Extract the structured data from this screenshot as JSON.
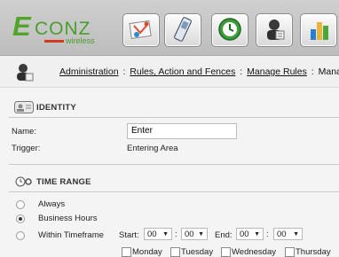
{
  "logo": {
    "letter": "E",
    "text": "CONZ",
    "sub": "wireless"
  },
  "toolbar": {
    "buttons": [
      {
        "name": "map-icon"
      },
      {
        "name": "phone-icon"
      },
      {
        "name": "clock-icon"
      },
      {
        "name": "user-admin-icon"
      },
      {
        "name": "chart-icon"
      }
    ]
  },
  "breadcrumb": {
    "items": [
      "Administration",
      "Rules, Action and Fences",
      "Manage Rules",
      "Manag"
    ],
    "separator": ":"
  },
  "identity": {
    "title": "IDENTITY",
    "name_label": "Name:",
    "name_value": "Enter",
    "trigger_label": "Trigger:",
    "trigger_value": "Entering Area"
  },
  "time_range": {
    "title": "TIME RANGE",
    "options": [
      "Always",
      "Business Hours",
      "Within Timeframe"
    ],
    "selected": "Business Hours",
    "start_label": "Start:",
    "end_label": "End:",
    "start_hour": "00",
    "start_min": "00",
    "end_hour": "00",
    "end_min": "00",
    "colon": ":",
    "days": [
      "Monday",
      "Tuesday",
      "Wednesday",
      "Thursday"
    ]
  },
  "colors": {
    "brand_green": "#4fa62a",
    "brand_red": "#d43a1f"
  }
}
